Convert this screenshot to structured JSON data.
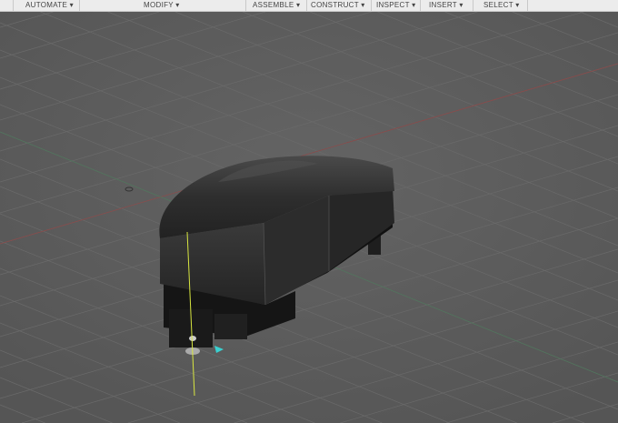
{
  "toolbar": {
    "menus": [
      {
        "label": "AUTOMATE ▾"
      },
      {
        "label": "MODIFY ▾"
      },
      {
        "label": "ASSEMBLE ▾"
      },
      {
        "label": "CONSTRUCT ▾"
      },
      {
        "label": "INSPECT ▾"
      },
      {
        "label": "INSERT ▾"
      },
      {
        "label": "SELECT ▾"
      }
    ]
  },
  "colors": {
    "background": "#5a5a5a",
    "grid": "#6a6a6a",
    "x_axis": "#8a4a4a",
    "y_axis": "#d8e640",
    "z_axis": "#4a8a5a",
    "body": "#2a2a2a"
  }
}
